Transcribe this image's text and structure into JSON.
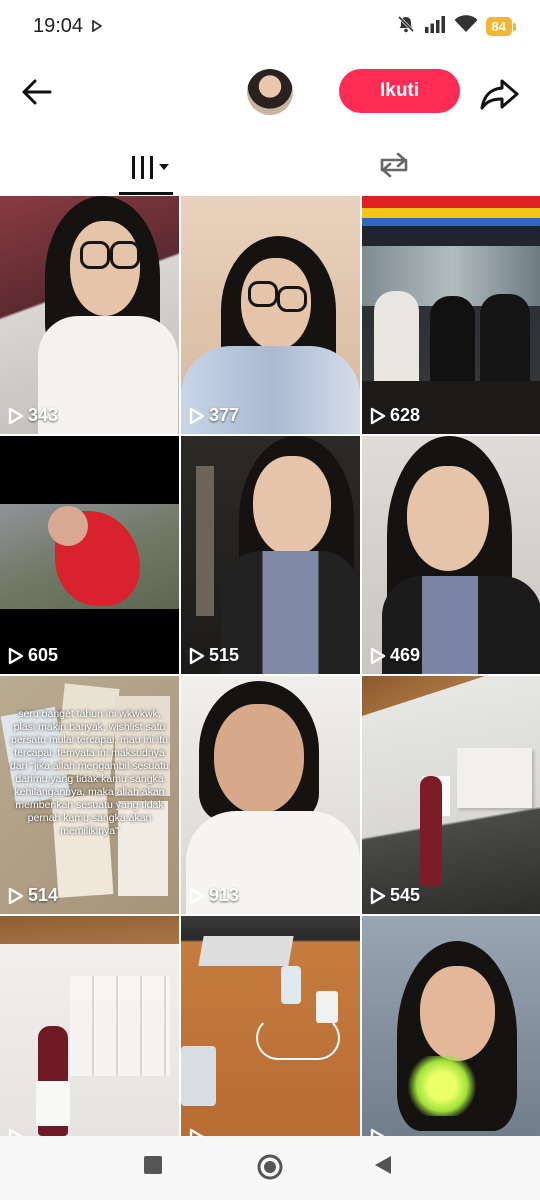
{
  "status_bar": {
    "time": "19:04",
    "battery": "84"
  },
  "header": {
    "follow_label": "Ikuti"
  },
  "tabs": [
    {
      "name": "videos"
    },
    {
      "name": "reposts"
    }
  ],
  "videos": [
    {
      "views": "343"
    },
    {
      "views": "377"
    },
    {
      "views": "628"
    },
    {
      "views": "605"
    },
    {
      "views": "515"
    },
    {
      "views": "469"
    },
    {
      "views": "514",
      "caption": "seru banget tahun ini wkwkwk, plasi makin banyak, wishlist satu persatu mulai tercapai, mau ini itu tercapai. temyata ini maksudnya dari \"jika allah mengambil sesuatu darimu yang tidak kamu sangka kehilangannya, maka allah akan memberikan sesuatu yang tidak pernah kamu sangka akan memilikinya\""
    },
    {
      "views": "913"
    },
    {
      "views": "545"
    },
    {
      "views": ""
    },
    {
      "views": ""
    },
    {
      "views": ""
    }
  ],
  "colors": {
    "accent": "#fe2c55",
    "battery": "#f2b632"
  }
}
